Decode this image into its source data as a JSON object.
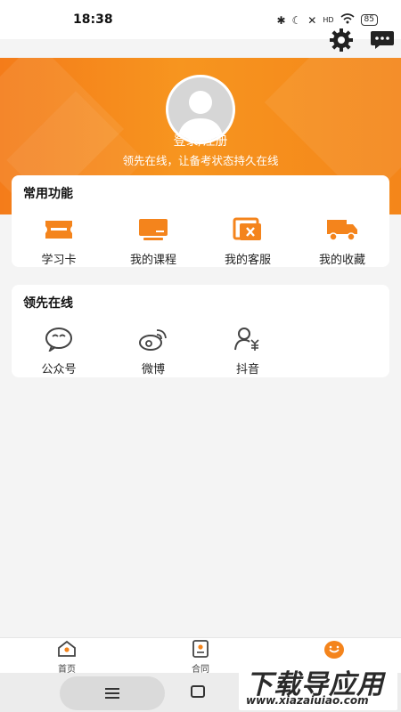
{
  "status_bar": {
    "time": "18:38",
    "battery": "85",
    "network": "HD"
  },
  "header": {
    "settings_icon": "gear-icon",
    "message_icon": "chat-bubble-icon",
    "login_label": "登录/注册",
    "tagline": "领先在线，让备考状态持久在线"
  },
  "common": {
    "title": "常用功能",
    "items": [
      {
        "label": "学习卡",
        "icon": "ticket-card-icon"
      },
      {
        "label": "我的课程",
        "icon": "monitor-icon"
      },
      {
        "label": "我的客服",
        "icon": "customer-service-icon"
      },
      {
        "label": "我的收藏",
        "icon": "delivery-truck-icon"
      }
    ]
  },
  "online": {
    "title": "领先在线",
    "items": [
      {
        "label": "公众号",
        "icon": "wechat-icon"
      },
      {
        "label": "微博",
        "icon": "weibo-icon"
      },
      {
        "label": "抖音",
        "icon": "douyin-icon"
      }
    ]
  },
  "bottom_nav": {
    "items": [
      {
        "label": "首页",
        "icon": "home-icon"
      },
      {
        "label": "合同",
        "icon": "contract-icon"
      },
      {
        "label": "",
        "icon": "smile-face-icon"
      }
    ]
  },
  "watermark": {
    "title": "下载导应用",
    "url": "www.xiazaiuiao.com"
  },
  "colors": {
    "accent": "#f4841c",
    "background": "#f4f4f4",
    "card": "#ffffff"
  }
}
